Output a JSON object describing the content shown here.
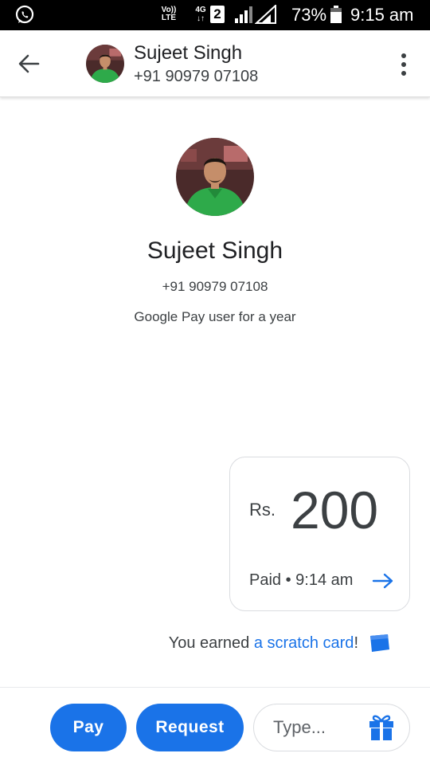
{
  "status_bar": {
    "volte_line1": "Vo))",
    "volte_line2": "LTE",
    "network_top": "4G",
    "network_bottom": "↓↑",
    "sim_slot": "2",
    "battery_percent": "73%",
    "time": "9:15 am",
    "notification_icon": "whatsapp-icon"
  },
  "header": {
    "back_icon": "arrow-left-icon",
    "contact_name": "Sujeet Singh",
    "contact_phone": "+91 90979 07108",
    "menu_icon": "more-vertical-icon"
  },
  "profile": {
    "name": "Sujeet Singh",
    "phone": "+91 90979 07108",
    "member_since": "Google Pay user for a year"
  },
  "payment": {
    "currency": "Rs.",
    "amount": "200",
    "status": "Paid • 9:14 am",
    "arrow_icon": "arrow-right-icon"
  },
  "reward": {
    "prefix": "You earned ",
    "link": "a scratch card",
    "suffix": "!",
    "icon": "scratch-card-icon"
  },
  "bottom_bar": {
    "pay_label": "Pay",
    "request_label": "Request",
    "message_placeholder": "Type...",
    "gift_icon": "gift-icon"
  },
  "colors": {
    "accent": "#1a73e8",
    "text_primary": "#202124",
    "text_secondary": "#3c4043",
    "border": "#dadce0",
    "status_bar": "#000000"
  }
}
